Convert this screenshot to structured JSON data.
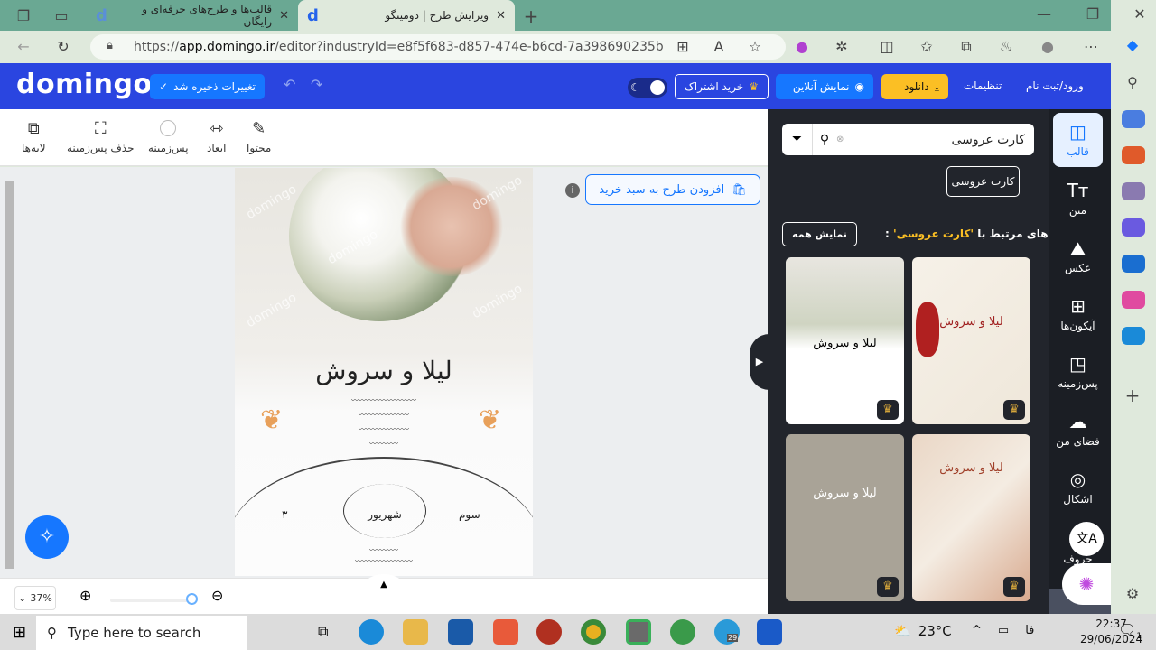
{
  "browser": {
    "tabs": [
      {
        "title": "قالب‌ها و طرح‌های حرفه‌ای و رایگان",
        "active": false
      },
      {
        "title": "ویرایش طرح | دومینگو",
        "active": true
      }
    ],
    "url_prefix": "https://",
    "url_host": "app.domingo.ir",
    "url_path": "/editor?industryId=e8f5f683-d857-474e-b6cd-7a398690235b"
  },
  "header": {
    "logo": "domingo",
    "saved_label": "تغییرات ذخیره شد",
    "subscribe_label": "خرید اشتراک",
    "live_preview_label": "نمایش آنلاین",
    "download_label": "دانلود",
    "settings_label": "تنظیمات",
    "login_label": "ورود/ثبت نام"
  },
  "toolbar": {
    "items": [
      {
        "label": "محتوا",
        "icon": "edit-icon"
      },
      {
        "label": "ابعاد",
        "icon": "resize-icon"
      },
      {
        "label": "پس‌زمینه",
        "icon": "background-color-icon"
      },
      {
        "label": "حذف پس‌زمینه",
        "icon": "remove-background-icon"
      },
      {
        "label": "لایه‌ها",
        "icon": "layers-icon"
      }
    ]
  },
  "canvas": {
    "add_to_cart_label": "افزودن طرح به سبد خرید",
    "watermark": "domingo",
    "card_title": "لیلا و سروش",
    "card_month": "شهریور",
    "card_day": "سوم"
  },
  "zoom": {
    "level_label": "37%",
    "level": 37
  },
  "panel": {
    "search_value": "کارت عروسی",
    "suggestion_chip": "کارت عروسی",
    "related_prefix": "طرح‌های مرتبط با ",
    "related_query": "'کارت عروسی'",
    "related_suffix": " :",
    "show_all_label": "نمایش همه",
    "thumbnail_titles": [
      "لیلا و سروش",
      "لیلا و سروش",
      "لیلا و سروش",
      "لیلا و سروش"
    ]
  },
  "nav": {
    "items": [
      {
        "label": "قالب",
        "icon": "template-icon"
      },
      {
        "label": "متن",
        "icon": "text-icon"
      },
      {
        "label": "عکس",
        "icon": "image-icon"
      },
      {
        "label": "آیکون‌ها",
        "icon": "icons-grid-icon"
      },
      {
        "label": "پس‌زمینه",
        "icon": "background-icon"
      },
      {
        "label": "فضای من",
        "icon": "cloud-upload-icon"
      },
      {
        "label": "اشکال",
        "icon": "shapes-icon"
      },
      {
        "label": "حروف",
        "icon": "fonts-icon"
      }
    ]
  },
  "taskbar": {
    "search_placeholder": "Type here to search",
    "temperature": "23°C",
    "language": "فا",
    "time": "22:37",
    "date": "29/06/2024",
    "telegram_badge": "29",
    "notification_count": "1"
  },
  "colors": {
    "brand": "#2a45e0",
    "primary": "#1677ff",
    "download": "#fbbf24",
    "panel": "#22252c"
  }
}
